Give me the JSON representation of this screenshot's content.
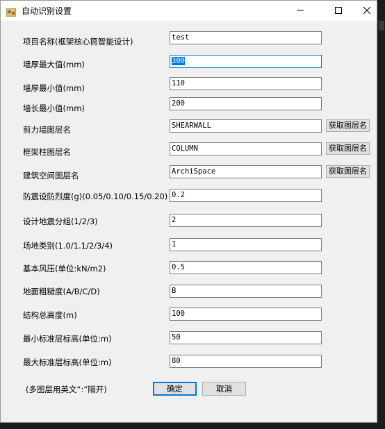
{
  "window": {
    "title": "自动识别设置"
  },
  "rows": [
    {
      "label": "项目名称(框架核心筒智能设计)",
      "value": "test"
    },
    {
      "label": "墙厚最大值(mm)",
      "value": "300"
    },
    {
      "label": "墙厚最小值(mm)",
      "value": "110"
    },
    {
      "label": "墙长最小值(mm)",
      "value": "200"
    },
    {
      "label": "剪力墙图层名",
      "value": "SHEARWALL",
      "button": "获取图层名"
    },
    {
      "label": "框架柱图层名",
      "value": "COLUMN",
      "button": "获取图层名"
    },
    {
      "label": "建筑空间图层名",
      "value": "ArchiSpace",
      "button": "获取图层名"
    },
    {
      "label": "防震设防烈度(g)(0.05/0.10/0.15/0.20)",
      "value": "0.2"
    },
    {
      "label": "设计地震分组(1/2/3)",
      "value": "2"
    },
    {
      "label": "场地类别(1.0/1.1/2/3/4)",
      "value": "1"
    },
    {
      "label": "基本风压(单位:kN/m2)",
      "value": "0.5"
    },
    {
      "label": "地面粗糙度(A/B/C/D)",
      "value": "B"
    },
    {
      "label": "结构总高度(m)",
      "value": "100"
    },
    {
      "label": "最小标准层标高(单位:m)",
      "value": "50"
    },
    {
      "label": "最大标准层标高(单位:m)",
      "value": "80"
    }
  ],
  "footer": {
    "hint": "(多图层用英文“:”隔开)",
    "ok_label": "确定",
    "cancel_label": "取消"
  },
  "colors": {
    "accent": "#0078d7",
    "window_bg": "#f0f0f0",
    "button_bg": "#e1e1e1"
  },
  "icons": {
    "app": "app-window-icon",
    "minimize": "minimize-icon",
    "maximize": "maximize-icon",
    "close": "close-icon"
  }
}
